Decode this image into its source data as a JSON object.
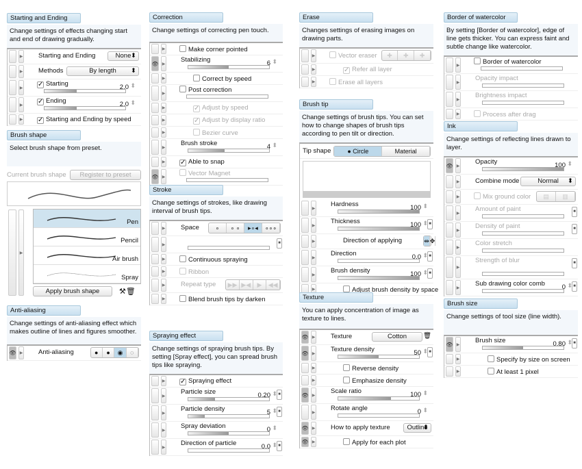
{
  "panels": [
    {
      "key": "starting_ending",
      "title": "Starting and Ending",
      "desc": "Change settings of effects changing start and end of drawing gradually.",
      "rows": [
        {
          "type": "select",
          "label": "Starting and Ending",
          "value": "None"
        },
        {
          "type": "select",
          "label": "Methods",
          "value": "By length"
        },
        {
          "type": "slider",
          "label": "Starting",
          "check": true,
          "value": "2.0",
          "fill": 0.4
        },
        {
          "type": "slider",
          "label": "Ending",
          "check": true,
          "value": "2.0",
          "fill": 0.4
        },
        {
          "type": "check",
          "label": "Starting and Ending by speed",
          "checked": true
        }
      ]
    },
    {
      "key": "anti_aliasing",
      "title": "Anti-aliasing",
      "desc": "Change settings of anti-aliasing effect which makes outline of lines and figures smoother.",
      "rows": [
        {
          "type": "seg",
          "label": "Anti-aliasing",
          "options": [
            "●",
            "●",
            "◉",
            "◌"
          ],
          "selected": 2,
          "eye": true
        }
      ]
    },
    {
      "key": "correction",
      "title": "Correction",
      "desc": "Change settings of correcting pen touch.",
      "rows": [
        {
          "type": "check",
          "label": "Make corner pointed",
          "checked": false
        },
        {
          "type": "slider",
          "label": "Stabilizing",
          "value": "6",
          "fill": 0.5,
          "eye": true
        },
        {
          "type": "check",
          "label": "Correct by speed",
          "checked": false,
          "indent": true
        },
        {
          "type": "slider",
          "label": "Post correction",
          "check": false,
          "fill": 0
        },
        {
          "type": "check",
          "label": "Adjust by speed",
          "checked": true,
          "disabled": true,
          "indent": true
        },
        {
          "type": "check",
          "label": "Adjust by display ratio",
          "checked": true,
          "disabled": true,
          "indent": true
        },
        {
          "type": "check",
          "label": "Bezier curve",
          "checked": false,
          "disabled": true,
          "indent": true
        },
        {
          "type": "slider",
          "label": "Brush stroke",
          "value": "4",
          "fill": 0.45
        },
        {
          "type": "check",
          "label": "Able to snap",
          "checked": true
        },
        {
          "type": "slider",
          "label": "Vector Magnet",
          "check": false,
          "fill": 0,
          "disabled": true,
          "eye": true
        }
      ]
    },
    {
      "key": "stroke",
      "title": "Stroke",
      "desc": "Change settings of strokes, like drawing interval of brush tips.",
      "rows": [
        {
          "type": "seg",
          "label": "Space",
          "options": [
            "∘",
            "∘ ∘",
            "▸∘◂",
            "∘∘∘"
          ],
          "selected": 2
        },
        {
          "type": "slider",
          "label": "",
          "fill": 0,
          "extra": true
        },
        {
          "type": "check",
          "label": "Continuous spraying",
          "checked": false
        },
        {
          "type": "check",
          "label": "Ribbon",
          "checked": false,
          "disabled": true
        },
        {
          "type": "seg",
          "label": "Repeat type",
          "options": [
            "▶▶",
            "▶◀",
            "▶",
            "◀◀"
          ],
          "selected": -1,
          "disabled": true
        },
        {
          "type": "check",
          "label": "Blend brush tips by darken",
          "checked": false
        }
      ]
    },
    {
      "key": "spraying",
      "title": "Spraying effect",
      "desc": "Change settings of spraying brush tips. By setting [Spray effect], you can spread brush tips like spraying.",
      "rows": [
        {
          "type": "check",
          "label": "Spraying effect",
          "checked": true
        },
        {
          "type": "slider",
          "label": "Particle size",
          "value": "0.20",
          "fill": 0.33,
          "extra": true
        },
        {
          "type": "slider",
          "label": "Particle density",
          "value": "5",
          "fill": 0.2,
          "extra": true
        },
        {
          "type": "slider",
          "label": "Spray deviation",
          "value": "0",
          "fill": 0.5
        },
        {
          "type": "slider",
          "label": "Direction of particle",
          "value": "0.0",
          "fill": 0,
          "extra": true
        }
      ]
    },
    {
      "key": "erase",
      "title": "Erase",
      "desc": "Changes settings of erasing images on drawing parts.",
      "rows": [
        {
          "type": "seg",
          "label": "Vector eraser",
          "check": false,
          "options": [
            "✚",
            "✚",
            "✚"
          ],
          "selected": -1,
          "disabled": true
        },
        {
          "type": "check",
          "label": "Refer all layer",
          "checked": true,
          "disabled": true,
          "indent": true
        },
        {
          "type": "check",
          "label": "Erase all layers",
          "checked": false,
          "disabled": true
        }
      ]
    },
    {
      "key": "brush_tip",
      "title": "Brush tip",
      "desc": "Change settings of brush tips. You can set how to change shapes of brush tips according to pen tilt or direction.",
      "tip_shape": {
        "label": "Tip shape",
        "options": [
          "● Circle",
          "Material"
        ],
        "selected": 0
      },
      "rows": [
        {
          "type": "slider",
          "label": "Hardness",
          "value": "100",
          "fill": 1
        },
        {
          "type": "slider",
          "label": "Thickness",
          "value": "100",
          "fill": 1,
          "extra": true
        },
        {
          "type": "seg",
          "label": "Direction of applying",
          "options": [
            "⇹",
            "✥"
          ],
          "selected": 0,
          "indent": true
        },
        {
          "type": "slider",
          "label": "Direction",
          "value": "0.0",
          "fill": 0,
          "extra": true
        },
        {
          "type": "slider",
          "label": "Brush density",
          "value": "100",
          "fill": 1,
          "extra": true
        },
        {
          "type": "check",
          "label": "Adjust brush density by space",
          "checked": false,
          "indent": true
        }
      ]
    },
    {
      "key": "texture",
      "title": "Texture",
      "desc": "You can apply concentration of image as texture to lines.",
      "rows": [
        {
          "type": "button",
          "label": "Texture",
          "value": "Cotton",
          "eye": true
        },
        {
          "type": "slider",
          "label": "Texture density",
          "value": "50",
          "fill": 0.5,
          "eye": true,
          "extra": true
        },
        {
          "type": "check",
          "label": "Reverse density",
          "checked": false,
          "indent": true
        },
        {
          "type": "check",
          "label": "Emphasize density",
          "checked": false,
          "indent": true
        },
        {
          "type": "slider",
          "label": "Scale ratio",
          "value": "100",
          "fill": 0.65,
          "eye": true
        },
        {
          "type": "slider",
          "label": "Rotate angle",
          "value": "0",
          "fill": 0
        },
        {
          "type": "select",
          "label": "How to apply texture",
          "value": "Outline",
          "eye": true
        },
        {
          "type": "check",
          "label": "Apply for each plot",
          "checked": false,
          "indent": true,
          "eye": true
        }
      ]
    },
    {
      "key": "border_watercolor",
      "title": "Border of watercolor",
      "desc": "By setting [Border of watercolor], edge of line gets thicker.  You can express faint and subtle change like watercolor.",
      "rows": [
        {
          "type": "slider",
          "label": "Border of watercolor",
          "check": false,
          "fill": 0
        },
        {
          "type": "slider",
          "label": "Opacity impact",
          "fill": 0,
          "disabled": true
        },
        {
          "type": "slider",
          "label": "Brightness impact",
          "fill": 0,
          "disabled": true
        },
        {
          "type": "check",
          "label": "Process after drag",
          "checked": false,
          "disabled": true
        }
      ]
    },
    {
      "key": "ink",
      "title": "Ink",
      "desc": "Change settings of reflecting lines drawn to layer.",
      "rows": [
        {
          "type": "slider",
          "label": "Opacity",
          "value": "100",
          "fill": 1,
          "eye": true
        },
        {
          "type": "select",
          "label": "Combine mode",
          "value": "Normal"
        },
        {
          "type": "seg",
          "label": "Mix ground color",
          "check": false,
          "options": [
            "▤",
            "▥"
          ],
          "selected": -1,
          "disabled": true
        },
        {
          "type": "slider",
          "label": "Amount of paint",
          "fill": 0,
          "disabled": true,
          "extra": true
        },
        {
          "type": "slider",
          "label": "Density of paint",
          "fill": 0,
          "disabled": true,
          "extra": true
        },
        {
          "type": "slider",
          "label": "Color stretch",
          "fill": 0,
          "disabled": true
        },
        {
          "type": "slider",
          "label": "Strength of blur",
          "fill": 0,
          "disabled": true,
          "extra": true,
          "tall": true
        },
        {
          "type": "slider",
          "label": "Sub drawing color comb",
          "value": "0",
          "fill": 0,
          "extra": true
        }
      ]
    },
    {
      "key": "brush_size",
      "title": "Brush size",
      "desc": "Change settings of tool size (line width).",
      "rows": [
        {
          "type": "slider",
          "label": "Brush size",
          "value": "0.80",
          "fill": 0.5,
          "eye": true,
          "extra": true
        },
        {
          "type": "check",
          "label": "Specify by size on screen",
          "checked": false,
          "indent": true
        },
        {
          "type": "check",
          "label": "At least 1 pixel",
          "checked": false,
          "indent": true
        }
      ]
    }
  ],
  "brush_shape": {
    "title": "Brush shape",
    "desc": "Select brush shape from preset.",
    "current_label": "Current brush shape",
    "register_label": "Register to preset",
    "items": [
      {
        "label": "Pen",
        "selected": true
      },
      {
        "label": "Pencil"
      },
      {
        "label": "Air brush"
      },
      {
        "label": "Spray"
      }
    ],
    "apply_label": "Apply brush shape"
  },
  "colors": {
    "title_tab": "#c9e0f0",
    "selected": "#bcd8ea",
    "desc_bg": "#f3f7fb"
  }
}
